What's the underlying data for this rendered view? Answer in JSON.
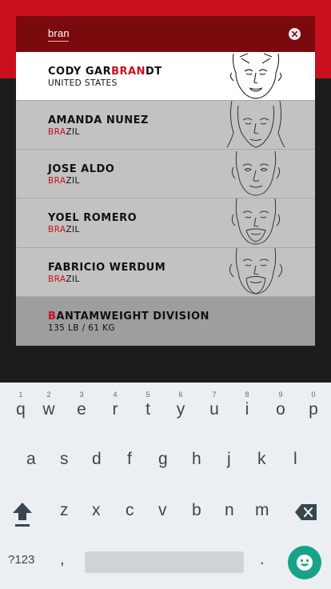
{
  "search": {
    "query": "bran",
    "clear_icon": "close-icon"
  },
  "results": [
    {
      "pre": "CODY GAR",
      "hl": "BRAN",
      "post": "DT",
      "sub_hl": "",
      "sub_post": "UNITED STATES",
      "icon": "fighter-portrait-icon"
    },
    {
      "pre": "AMANDA NUNEZ",
      "hl": "",
      "post": "",
      "sub_hl": "BRA",
      "sub_post": "ZIL",
      "icon": "fighter-portrait-icon"
    },
    {
      "pre": "JOSE ALDO",
      "hl": "",
      "post": "",
      "sub_hl": "BRA",
      "sub_post": "ZIL",
      "icon": "fighter-portrait-icon"
    },
    {
      "pre": "YOEL ROMERO",
      "hl": "",
      "post": "",
      "sub_hl": "BRA",
      "sub_post": "ZIL",
      "icon": "fighter-portrait-icon"
    },
    {
      "pre": "FABRICIO WERDUM",
      "hl": "",
      "post": "",
      "sub_hl": "BRA",
      "sub_post": "ZIL",
      "icon": "fighter-portrait-icon"
    }
  ],
  "division": {
    "hl": "B",
    "post": "ANTAMWEIGHT DIVISION",
    "sub": "135 LB / 61 KG"
  },
  "keyboard": {
    "row1": [
      {
        "num": "1",
        "ch": "q"
      },
      {
        "num": "2",
        "ch": "w"
      },
      {
        "num": "3",
        "ch": "e"
      },
      {
        "num": "4",
        "ch": "r"
      },
      {
        "num": "5",
        "ch": "t"
      },
      {
        "num": "6",
        "ch": "y"
      },
      {
        "num": "7",
        "ch": "u"
      },
      {
        "num": "8",
        "ch": "i"
      },
      {
        "num": "9",
        "ch": "o"
      },
      {
        "num": "0",
        "ch": "p"
      }
    ],
    "row2": [
      "a",
      "s",
      "d",
      "f",
      "g",
      "h",
      "j",
      "k",
      "l"
    ],
    "row3": [
      "z",
      "x",
      "c",
      "v",
      "b",
      "n",
      "m"
    ],
    "symbols_label": "?123",
    "comma": ",",
    "period": ".",
    "shift_icon": "shift-arrow-icon",
    "backspace_icon": "backspace-icon",
    "emoji_icon": "emoji-smiley-icon"
  },
  "colors": {
    "brand_red": "#c8101e",
    "search_bar": "#7b0a0e",
    "emoji_key": "#16a38a"
  }
}
